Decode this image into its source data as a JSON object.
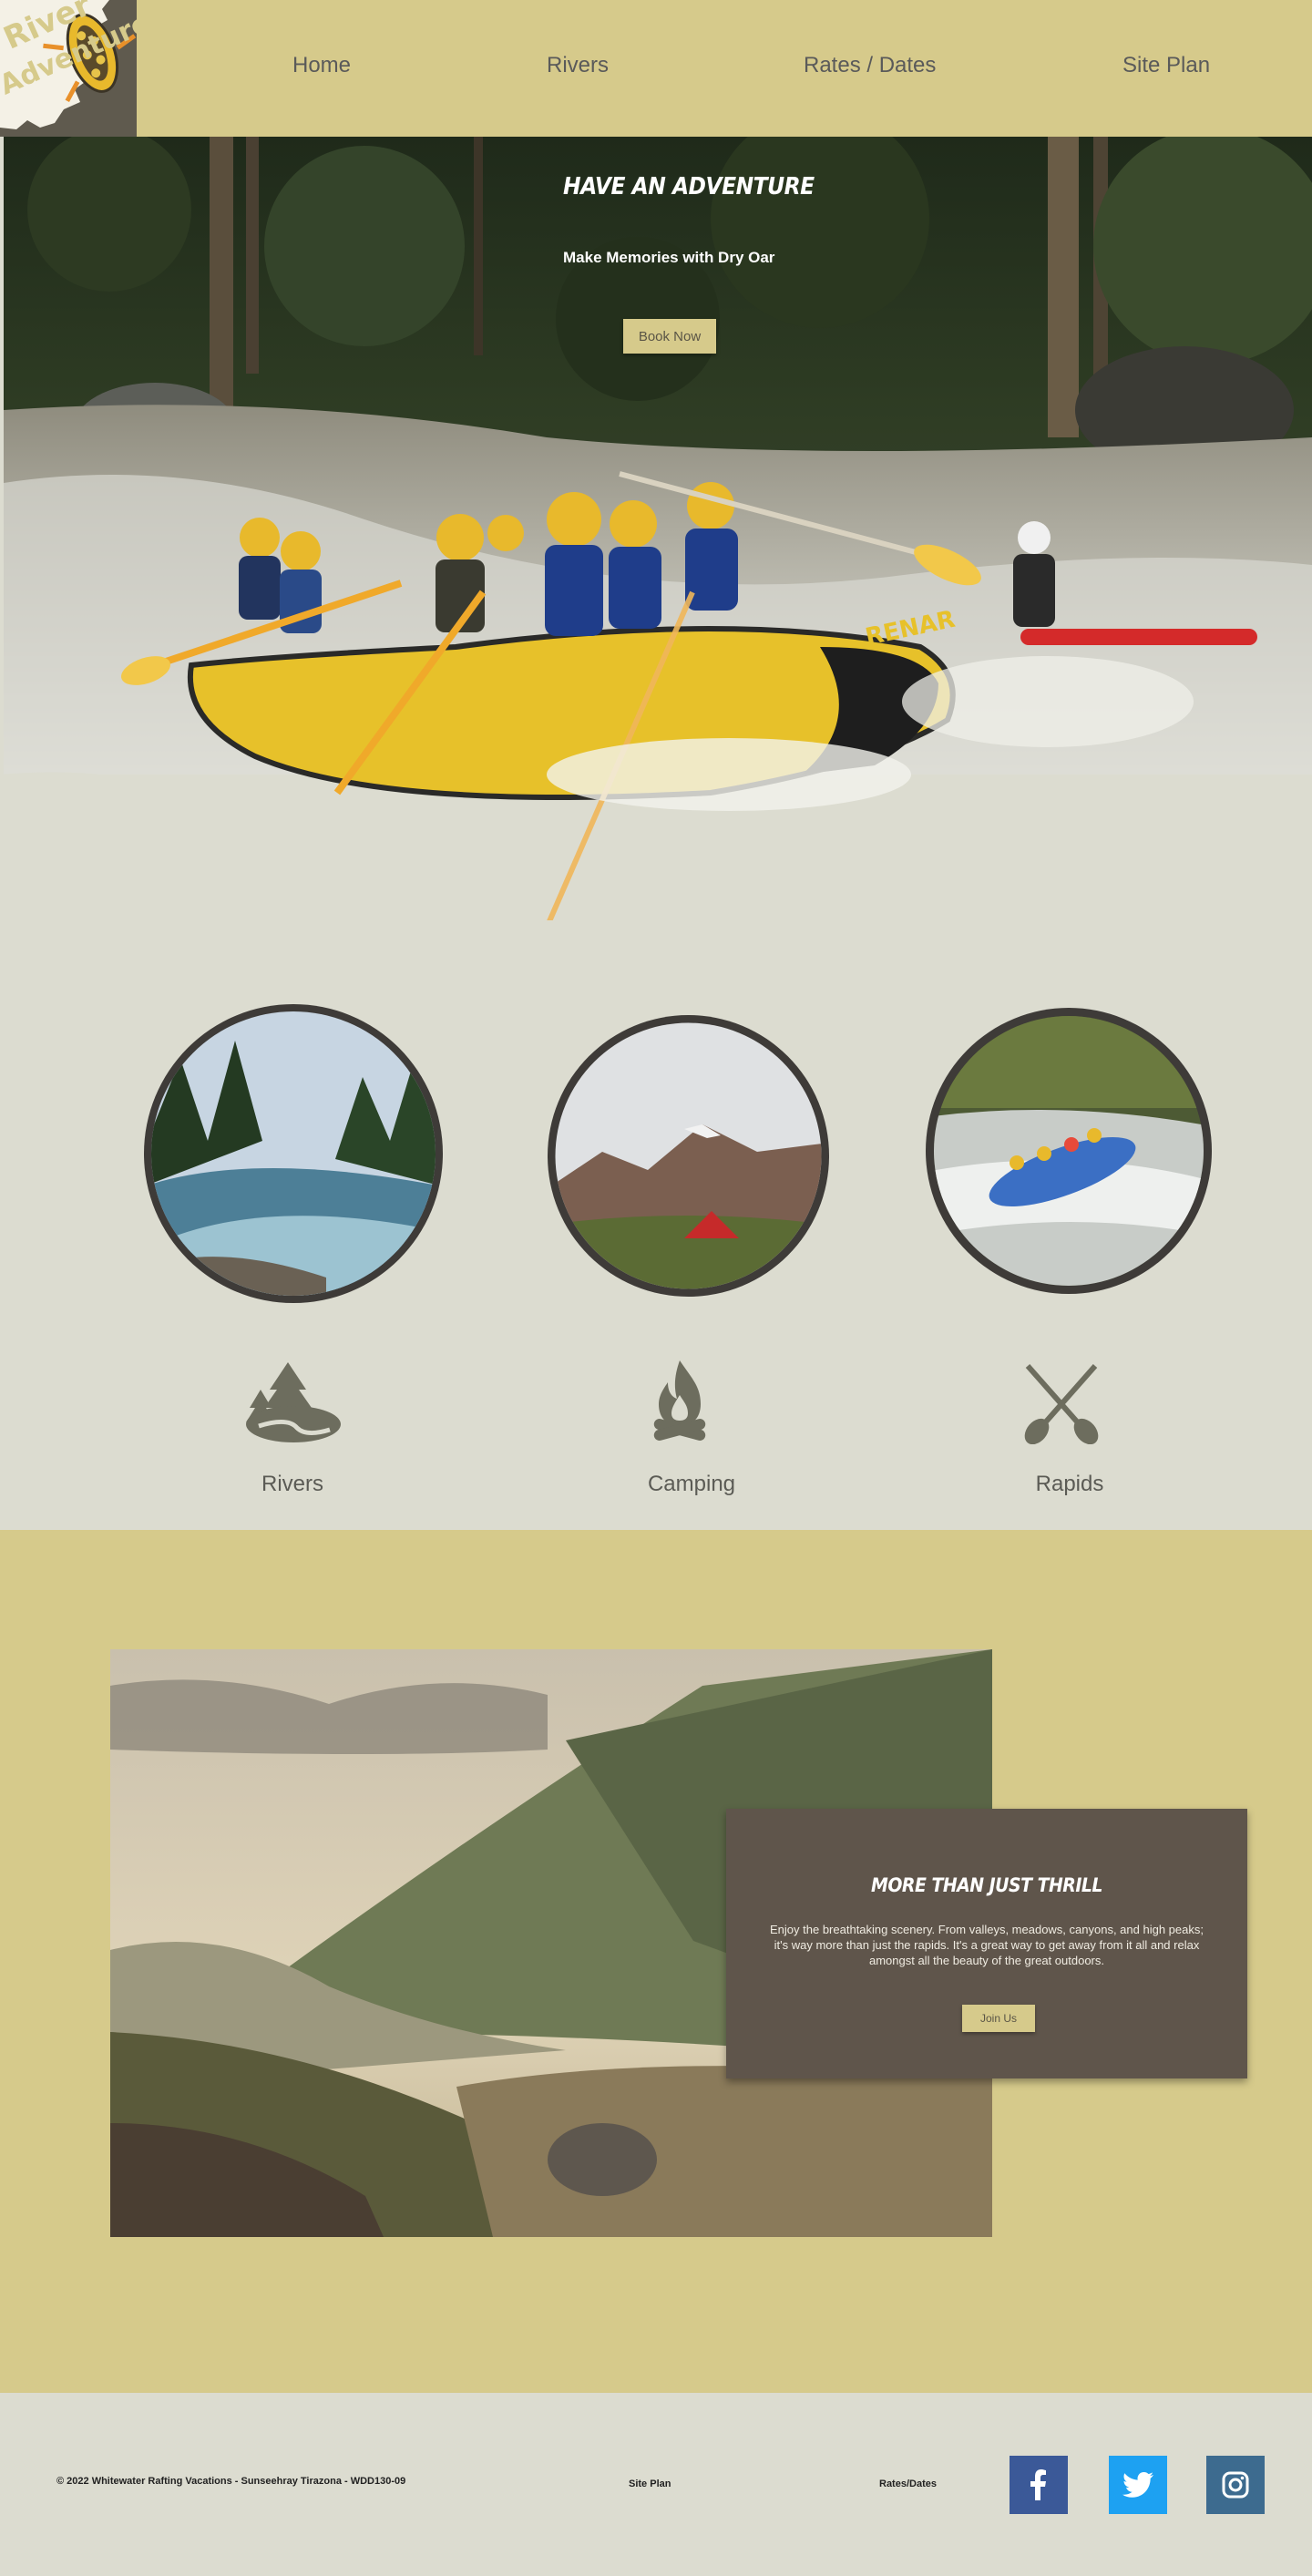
{
  "header": {
    "logo_text_1": "River",
    "logo_text_2": "Adventure",
    "nav": [
      {
        "label": "Home"
      },
      {
        "label": "Rivers"
      },
      {
        "label": "Rates / Dates"
      },
      {
        "label": "Site Plan"
      }
    ]
  },
  "hero": {
    "title": "Have an Adventure",
    "subtitle": "Make Memories with Dry Oar",
    "button_label": "Book Now",
    "raft_text": "RENAR"
  },
  "features": [
    {
      "label": "Rivers",
      "icon": "trees-river-icon"
    },
    {
      "label": "Camping",
      "icon": "campfire-icon"
    },
    {
      "label": "Rapids",
      "icon": "crossed-paddles-icon"
    }
  ],
  "thrill": {
    "title": "More Than Just Thrill",
    "body": "Enjoy the breathtaking scenery. From valleys, meadows, canyons, and high peaks; it's way more than just the rapids. It's a great way to get away from it all and relax amongst all the beauty of the great outdoors.",
    "button_label": "Join Us"
  },
  "footer": {
    "copyright": "© 2022 Whitewater Rafting Vacations - Sunseehray Tirazona - WDD130-09",
    "links": [
      {
        "label": "Site Plan"
      },
      {
        "label": "Rates/Dates"
      }
    ],
    "social": [
      {
        "name": "facebook-icon",
        "color": "#3b5998"
      },
      {
        "name": "twitter-icon",
        "color": "#1da1f2"
      },
      {
        "name": "instagram-icon",
        "color": "#3d6b8f"
      }
    ]
  },
  "colors": {
    "header_bg": "#d6ca8b",
    "page_bg": "#dcdcd0",
    "card_bg": "#5f554b",
    "accent": "#d6ca8b"
  }
}
